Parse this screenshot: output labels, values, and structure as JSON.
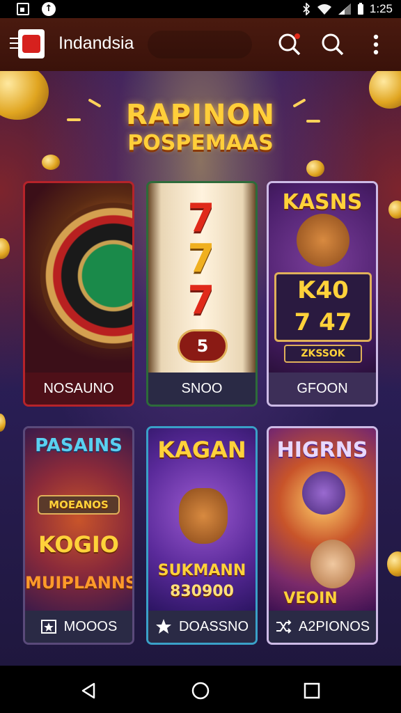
{
  "status_bar": {
    "time": "1:25",
    "icons": [
      "notification-box-icon",
      "upload-circle-icon",
      "bluetooth-icon",
      "wifi-icon",
      "signal-icon",
      "battery-icon"
    ]
  },
  "app_bar": {
    "title": "Indandsia",
    "icons": [
      "menu-logo-icon",
      "notification-search-icon",
      "search-icon",
      "more-vert-icon"
    ],
    "accent": "#4a1a0f"
  },
  "promo": {
    "line1": "RAPINON",
    "line2": "POSPEMAAS"
  },
  "cards": [
    {
      "label": "NOSAUNO",
      "art": "roulette"
    },
    {
      "label": "SNOO",
      "art": "slot-reels",
      "reels": [
        "7",
        "7",
        "7"
      ],
      "badge": "5"
    },
    {
      "label": "GFOON",
      "art": "KASNS",
      "panel_top": "K40",
      "panel_bottom": "7 47",
      "tag": "ZKSSOK"
    },
    {
      "label": "MOOOS",
      "art": "PASAINS",
      "sub1": "MOEANOS",
      "sub2": "KOGIO",
      "sub3": "MUIPLANNS",
      "icon": "box-star-icon"
    },
    {
      "label": "DOASSNO",
      "art": "KAGAN",
      "sub1": "SUKMANN",
      "sub2": "830900",
      "icon": "star-icon"
    },
    {
      "label": "A2PIONOS",
      "art": "HIGRNS",
      "sub1": "VEOIN",
      "icon": "shuffle-icon"
    }
  ],
  "nav": {
    "buttons": [
      "back-button",
      "home-button",
      "recents-button"
    ]
  },
  "colors": {
    "gold": "#ffcf3a",
    "card_label_bg": "#2a2a45",
    "nav_bg": "#000000"
  }
}
